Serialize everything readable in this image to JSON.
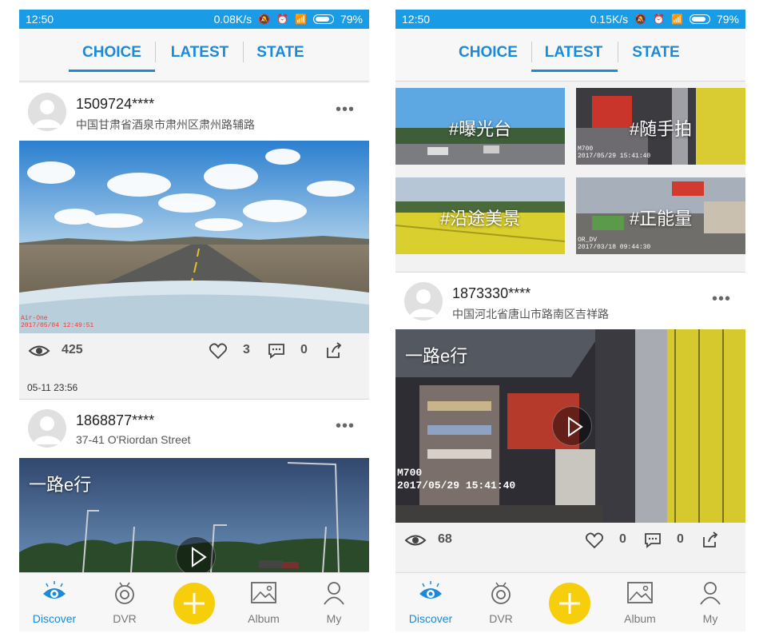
{
  "screens": [
    {
      "status": {
        "time": "12:50",
        "speed": "0.08K/s",
        "battery": "79%"
      },
      "tabs": [
        {
          "label": "CHOICE"
        },
        {
          "label": "LATEST"
        },
        {
          "label": "STATE"
        }
      ],
      "active_tab": "CHOICE",
      "posts": [
        {
          "user": "1509724****",
          "location": "中国甘肃省酒泉市肃州区肃州路辅路",
          "stamp": "Air-One\n2017/05/04 12:49:51",
          "views": "425",
          "likes": "3",
          "comments": "0",
          "time": "05-11 23:56"
        },
        {
          "user": "1868877****",
          "location": "37-41 O'Riordan Street",
          "caption": "一路e行"
        }
      ],
      "nav": [
        {
          "label": "Discover",
          "icon": "eye-icon"
        },
        {
          "label": "DVR",
          "icon": "camera-icon"
        },
        {
          "label": "",
          "icon": "plus-icon"
        },
        {
          "label": "Album",
          "icon": "image-icon"
        },
        {
          "label": "My",
          "icon": "person-icon"
        }
      ]
    },
    {
      "status": {
        "time": "12:50",
        "speed": "0.15K/s",
        "battery": "79%"
      },
      "tabs": [
        {
          "label": "CHOICE"
        },
        {
          "label": "LATEST"
        },
        {
          "label": "STATE"
        }
      ],
      "active_tab": "LATEST",
      "topics": [
        {
          "label": "#曝光台"
        },
        {
          "label": "#随手拍"
        },
        {
          "label": "#沿途美景"
        },
        {
          "label": "#正能量"
        }
      ],
      "topic_stamps": [
        "M700\n2017/05/29 15:41:40",
        "OR_DV\n2017/03/18 09:44:30"
      ],
      "posts": [
        {
          "user": "1873330****",
          "location": "中国河北省唐山市路南区吉祥路",
          "caption": "一路e行",
          "stamp": "M700\n2017/05/29 15:41:40",
          "views": "68",
          "likes": "0",
          "comments": "0"
        }
      ],
      "nav": [
        {
          "label": "Discover",
          "icon": "eye-icon"
        },
        {
          "label": "DVR",
          "icon": "camera-icon"
        },
        {
          "label": "",
          "icon": "plus-icon"
        },
        {
          "label": "Album",
          "icon": "image-icon"
        },
        {
          "label": "My",
          "icon": "person-icon"
        }
      ]
    }
  ],
  "colors": {
    "accent": "#1a8ad9",
    "statusbar": "#1a9be6",
    "add_button": "#f6ce0c"
  }
}
